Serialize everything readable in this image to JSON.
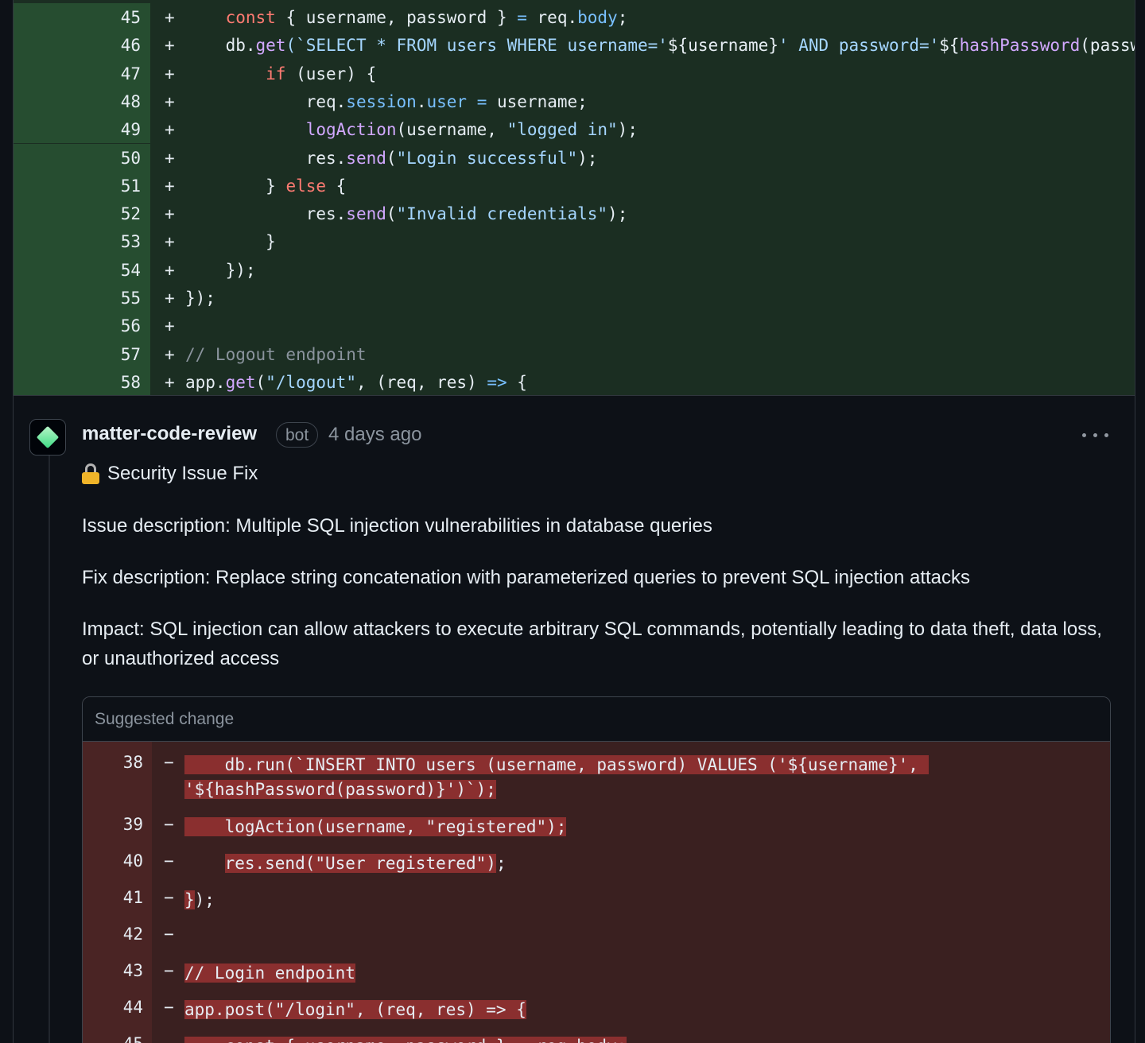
{
  "top_diff": {
    "lines": [
      {
        "num": "45",
        "sign": "+",
        "tokens": [
          {
            "t": "    "
          },
          {
            "t": "const",
            "c": "k"
          },
          {
            "t": " { username, password } "
          },
          {
            "t": "=",
            "c": "p"
          },
          {
            "t": " req."
          },
          {
            "t": "body",
            "c": "p"
          },
          {
            "t": ";"
          }
        ]
      },
      {
        "num": "46",
        "sign": "+",
        "tokens": [
          {
            "t": "    db."
          },
          {
            "t": "get",
            "c": "f"
          },
          {
            "t": "(`SELECT * FROM users WHERE username='",
            "c": "s"
          },
          {
            "t": "${username}"
          },
          {
            "t": "' AND password='",
            "c": "s"
          },
          {
            "t": "${"
          },
          {
            "t": "hashPassword",
            "c": "f"
          },
          {
            "t": "(password)}')`, (err, user) => {"
          }
        ]
      },
      {
        "num": "47",
        "sign": "+",
        "tokens": [
          {
            "t": "        "
          },
          {
            "t": "if",
            "c": "k"
          },
          {
            "t": " (user) {"
          }
        ]
      },
      {
        "num": "48",
        "sign": "+",
        "tokens": [
          {
            "t": "            req."
          },
          {
            "t": "session",
            "c": "p"
          },
          {
            "t": "."
          },
          {
            "t": "user",
            "c": "p"
          },
          {
            "t": " "
          },
          {
            "t": "=",
            "c": "p"
          },
          {
            "t": " username;"
          }
        ]
      },
      {
        "num": "49",
        "sign": "+",
        "tokens": [
          {
            "t": "            "
          },
          {
            "t": "logAction",
            "c": "f"
          },
          {
            "t": "(username, "
          },
          {
            "t": "\"logged in\"",
            "c": "s"
          },
          {
            "t": ");"
          }
        ]
      },
      {
        "num": "50",
        "sign": "+",
        "tokens": [
          {
            "t": "            res."
          },
          {
            "t": "send",
            "c": "f"
          },
          {
            "t": "("
          },
          {
            "t": "\"Login successful\"",
            "c": "s"
          },
          {
            "t": ");"
          }
        ]
      },
      {
        "num": "51",
        "sign": "+",
        "tokens": [
          {
            "t": "        } "
          },
          {
            "t": "else",
            "c": "k"
          },
          {
            "t": " {"
          }
        ]
      },
      {
        "num": "52",
        "sign": "+",
        "tokens": [
          {
            "t": "            res."
          },
          {
            "t": "send",
            "c": "f"
          },
          {
            "t": "("
          },
          {
            "t": "\"Invalid credentials\"",
            "c": "s"
          },
          {
            "t": ");"
          }
        ]
      },
      {
        "num": "53",
        "sign": "+",
        "tokens": [
          {
            "t": "        }"
          }
        ]
      },
      {
        "num": "54",
        "sign": "+",
        "tokens": [
          {
            "t": "    });"
          }
        ]
      },
      {
        "num": "55",
        "sign": "+",
        "tokens": [
          {
            "t": "});"
          }
        ]
      },
      {
        "num": "56",
        "sign": "+",
        "tokens": []
      },
      {
        "num": "57",
        "sign": "+",
        "tokens": [
          {
            "t": "// Logout endpoint",
            "c": "c"
          }
        ]
      },
      {
        "num": "58",
        "sign": "+",
        "tokens": [
          {
            "t": "app."
          },
          {
            "t": "get",
            "c": "f"
          },
          {
            "t": "("
          },
          {
            "t": "\"/logout\"",
            "c": "s"
          },
          {
            "t": ", (req, res) "
          },
          {
            "t": "=>",
            "c": "p"
          },
          {
            "t": " {"
          }
        ]
      }
    ]
  },
  "comment": {
    "author": "matter-code-review",
    "badge": "bot",
    "time": "4 days ago",
    "heading": "Security Issue Fix",
    "paragraphs": [
      "Issue description: Multiple SQL injection vulnerabilities in database queries",
      "Fix description: Replace string concatenation with parameterized queries to prevent SQL injection attacks",
      "Impact: SQL injection can allow attackers to execute arbitrary SQL commands, potentially leading to data theft, data loss, or unauthorized access"
    ]
  },
  "suggestion": {
    "title": "Suggested change",
    "lines": [
      {
        "num": "38",
        "sign": "−",
        "segments": [
          {
            "t": "    db.run(`INSERT INTO users (username, password) VALUES ('${username}', ",
            "hl": true
          },
          {
            "t": "\n"
          },
          {
            "t": "'${hashPassword(password)}')`);",
            "hl": true
          }
        ]
      },
      {
        "num": "39",
        "sign": "−",
        "segments": [
          {
            "t": "    logAction(username, \"registered\");",
            "hl": true
          }
        ]
      },
      {
        "num": "40",
        "sign": "−",
        "segments": [
          {
            "t": "    "
          },
          {
            "t": "res.send(\"User registered\")",
            "hl": true
          },
          {
            "t": ";"
          }
        ]
      },
      {
        "num": "41",
        "sign": "−",
        "segments": [
          {
            "t": "}",
            "hl": true
          },
          {
            "t": ");"
          }
        ]
      },
      {
        "num": "42",
        "sign": "−",
        "segments": []
      },
      {
        "num": "43",
        "sign": "−",
        "segments": [
          {
            "t": "// Login endpoint",
            "hl": true
          }
        ]
      },
      {
        "num": "44",
        "sign": "−",
        "segments": [
          {
            "t": "app.post(\"/login\", (req, res) => {",
            "hl": true
          }
        ]
      },
      {
        "num": "45",
        "sign": "−",
        "segments": [
          {
            "t": "    const { username, password } = req.body;",
            "hl": true
          }
        ]
      }
    ]
  }
}
